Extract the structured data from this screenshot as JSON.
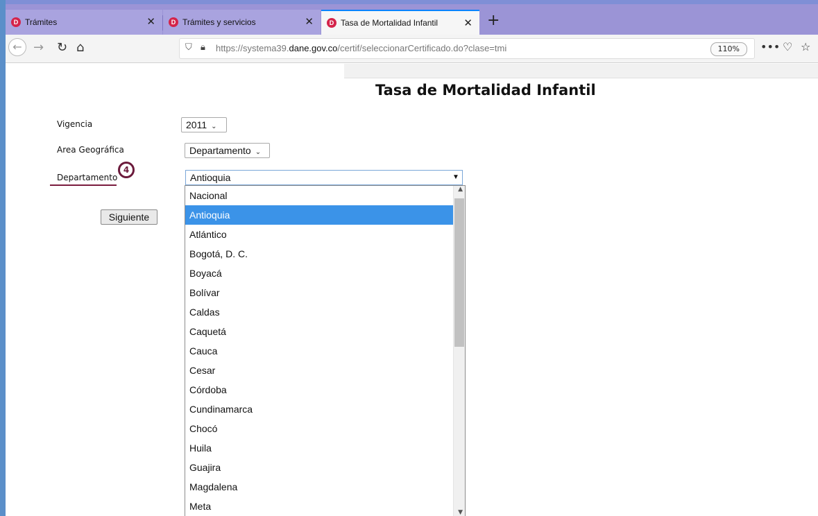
{
  "browser": {
    "tabs": [
      {
        "title": "Trámites",
        "logo": "D"
      },
      {
        "title": "Trámites y servicios",
        "logo": "D"
      },
      {
        "title": "Tasa de Mortalidad Infantil",
        "logo": "D"
      }
    ],
    "close_glyph": "✕",
    "new_tab": "+",
    "url_host_prefix": "https://systema39.",
    "url_host_domain": "dane.gov.co",
    "url_path": "/certif/seleccionarCertificado.do?clase=tmi",
    "zoom": "110%",
    "nav_icons": [
      "back-icon",
      "forward-icon",
      "reload-icon",
      "home-icon",
      "shield-icon",
      "lock-icon",
      "more-icon",
      "pocket-icon",
      "bookmark-star-icon"
    ]
  },
  "page": {
    "title": "Tasa de Mortalidad Infantil",
    "vigencia_label": "Vigencia",
    "vigencia_value": "2011",
    "area_label": "Area Geográfica",
    "area_value": "Departamento",
    "departamento_label": "Departamento",
    "departamento_value": "Antioquia",
    "step_badge": "4",
    "next_button": "Siguiente"
  },
  "dropdown": {
    "selected_index": 1,
    "options": [
      "Nacional",
      "Antioquia",
      "Atlántico",
      "Bogotá, D. C.",
      "Boyacá",
      "Bolívar",
      "Caldas",
      "Caquetá",
      "Cauca",
      "Cesar",
      "Córdoba",
      "Cundinamarca",
      "Chocó",
      "Huila",
      "Guajira",
      "Magdalena",
      "Meta"
    ]
  },
  "colors": {
    "tabstrip": "#9b94d6",
    "accent_selected": "#3b93e8",
    "badge": "#6b1a3b",
    "logo": "#d4244a"
  }
}
